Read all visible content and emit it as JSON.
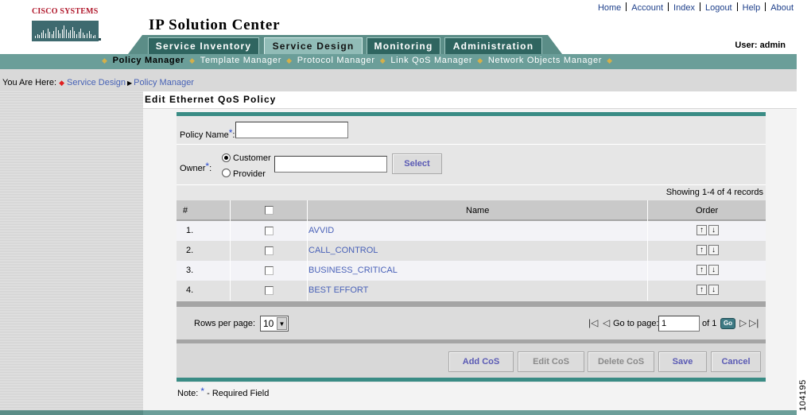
{
  "brand": {
    "logo_text": "Cisco Systems",
    "app_title": "IP Solution Center"
  },
  "top_links": [
    "Home",
    "Account",
    "Index",
    "Logout",
    "Help",
    "About"
  ],
  "user": "User: admin",
  "main_tabs": [
    {
      "label": "Service Inventory",
      "active": false
    },
    {
      "label": "Service Design",
      "active": true
    },
    {
      "label": "Monitoring",
      "active": false
    },
    {
      "label": "Administration",
      "active": false
    }
  ],
  "sub_nav": [
    "Policy Manager",
    "Template Manager",
    "Protocol Manager",
    "Link QoS Manager",
    "Network Objects Manager"
  ],
  "breadcrumb": {
    "prefix": "You Are Here:",
    "items": [
      "Service Design",
      "Policy Manager"
    ]
  },
  "page_title": "Edit Ethernet QoS Policy",
  "form": {
    "policy_name_label": "Policy Name",
    "policy_name_value": "",
    "owner_label": "Owner",
    "owner_options": [
      {
        "label": "Customer",
        "selected": true
      },
      {
        "label": "Provider",
        "selected": false
      }
    ],
    "owner_value": "",
    "select_button": "Select",
    "required_mark": "*"
  },
  "table": {
    "summary": "Showing 1-4 of 4 records",
    "headers": {
      "index": "#",
      "name": "Name",
      "order": "Order"
    },
    "rows": [
      {
        "index": "1.",
        "name": "AVVID"
      },
      {
        "index": "2.",
        "name": "CALL_CONTROL"
      },
      {
        "index": "3.",
        "name": "BUSINESS_CRITICAL"
      },
      {
        "index": "4.",
        "name": "BEST EFFORT"
      }
    ]
  },
  "pager": {
    "rows_per_page_label": "Rows per page:",
    "rows_per_page_value": "10",
    "go_to_label": "Go to page:",
    "page_value": "1",
    "of_label": "of 1",
    "go_button": "Go"
  },
  "actions": {
    "add": "Add CoS",
    "edit": "Edit CoS",
    "delete": "Delete CoS",
    "save": "Save",
    "cancel": "Cancel"
  },
  "note": {
    "prefix": "Note:",
    "mark": "*",
    "text": "- Required Field"
  },
  "figure_id": "104195",
  "colors": {
    "teal_nav": "#6b9e99",
    "tab_dark": "#2f6560",
    "link_blue": "#4a62b8",
    "logo_red": "#b0172b"
  }
}
